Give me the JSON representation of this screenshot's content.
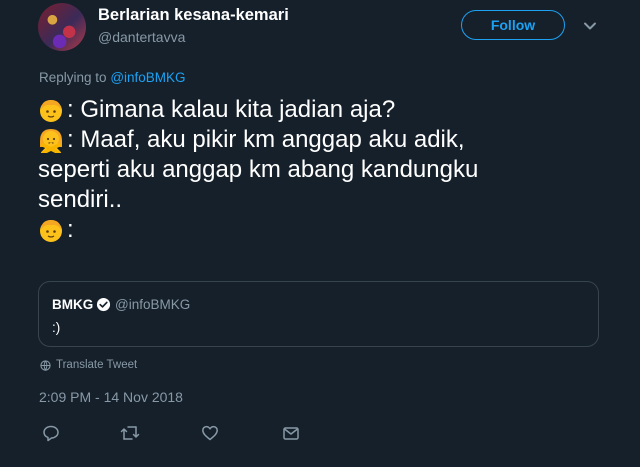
{
  "author": {
    "name": "Berlarian kesana-kemari",
    "handle": "@dantertavva"
  },
  "follow_label": "Follow",
  "reply": {
    "prefix": "Replying to",
    "to": "@infoBMKG"
  },
  "tweet_lines": [
    {
      "emoji": "boy-face",
      "text": ": Gimana kalau kita jadian aja?"
    },
    {
      "emoji": "girl-gesture-no",
      "text": ": Maaf, aku pikir km anggap aku adik,"
    },
    {
      "emoji": "",
      "text": "seperti aku anggap km abang kandungku"
    },
    {
      "emoji": "",
      "text": "sendiri.."
    },
    {
      "emoji": "boy-face",
      "text": ":"
    }
  ],
  "quoted": {
    "name": "BMKG",
    "handle": "@infoBMKG",
    "text": ":)"
  },
  "translate_label": "Translate Tweet",
  "timestamp": "2:09 PM - 14 Nov 2018",
  "colors": {
    "background": "#15202b",
    "accent": "#1da1f2",
    "muted": "#8899a6",
    "border": "#38444d"
  },
  "icons": [
    "chevron-down-icon",
    "verified-icon",
    "globe-icon",
    "reply-icon",
    "retweet-icon",
    "like-icon",
    "dm-icon"
  ]
}
